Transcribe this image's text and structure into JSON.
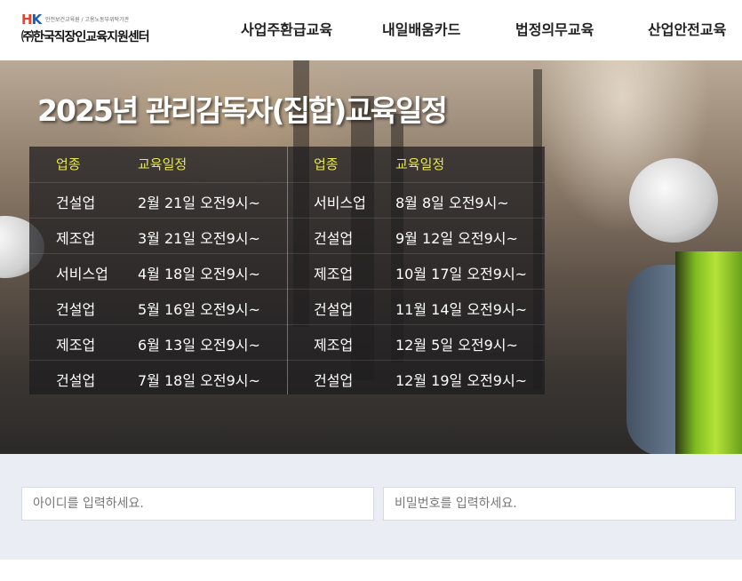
{
  "header": {
    "logo": {
      "mark_h": "H",
      "mark_k": "K",
      "tagline": "안전보건교육원 / 고용노동부위탁기관",
      "name": "㈜한국직장인교육지원센터"
    },
    "nav": [
      {
        "label": "사업주환급교육"
      },
      {
        "label": "내일배움카드"
      },
      {
        "label": "법정의무교육"
      },
      {
        "label": "산업안전교육"
      }
    ]
  },
  "banner": {
    "title": "2025년 관리감독자(집합)교육일정",
    "columns": {
      "industry": "업종",
      "schedule": "교육일정"
    },
    "left": [
      {
        "industry": "건설업",
        "schedule": "2월 21일 오전9시~"
      },
      {
        "industry": "제조업",
        "schedule": "3월 21일  오전9시~"
      },
      {
        "industry": "서비스업",
        "schedule": "4월 18일 오전9시~"
      },
      {
        "industry": "건설업",
        "schedule": "5월 16일 오전9시~"
      },
      {
        "industry": "제조업",
        "schedule": "6월 13일 오전9시~"
      },
      {
        "industry": "건설업",
        "schedule": "7월 18일 오전9시~"
      }
    ],
    "right": [
      {
        "industry": "서비스업",
        "schedule": "8월 8일 오전9시~"
      },
      {
        "industry": "건설업",
        "schedule": "9월 12일 오전9시~"
      },
      {
        "industry": "제조업",
        "schedule": "10월 17일 오전9시~"
      },
      {
        "industry": "건설업",
        "schedule": "11월 14일 오전9시~"
      },
      {
        "industry": "제조업",
        "schedule": "12월 5일 오전9시~"
      },
      {
        "industry": "건설업",
        "schedule": "12월 19일 오전9시~"
      }
    ]
  },
  "login": {
    "id_placeholder": "아이디를 입력하세요.",
    "pw_placeholder": "비밀번호를 입력하세요."
  },
  "colors": {
    "header_accent": "#e8e84a",
    "logo_h": "#e8432c",
    "logo_k": "#1e5bb8",
    "login_bg": "#eaeef4"
  }
}
